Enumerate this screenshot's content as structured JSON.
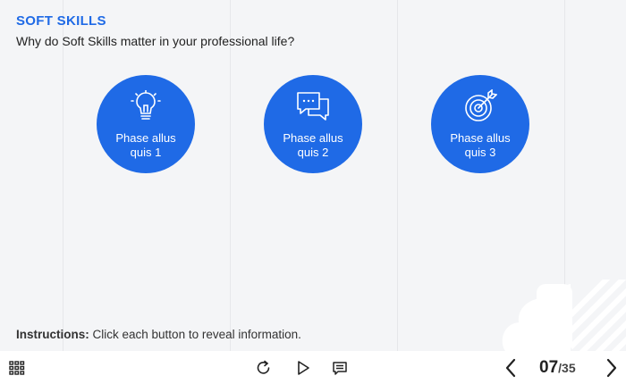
{
  "header": {
    "title": "SOFT SKILLS",
    "subtitle": "Why do Soft Skills matter in your professional life?"
  },
  "phases": [
    {
      "label": "Phase allus quis 1",
      "icon": "lightbulb-icon"
    },
    {
      "label": "Phase allus quis 2",
      "icon": "chat-bubbles-icon"
    },
    {
      "label": "Phase allus quis 3",
      "icon": "target-icon"
    }
  ],
  "instructions": {
    "prefix": "Instructions:",
    "text": " Click each button to reveal information."
  },
  "player": {
    "current_page": "07",
    "total_pages": "/35",
    "icons": [
      "grid-menu-icon",
      "replay-icon",
      "play-icon",
      "transcript-icon",
      "prev-arrow-icon",
      "next-arrow-icon"
    ]
  },
  "colors": {
    "accent": "#1f6ae6",
    "background": "#f4f5f7",
    "bar": "#ffffff"
  }
}
